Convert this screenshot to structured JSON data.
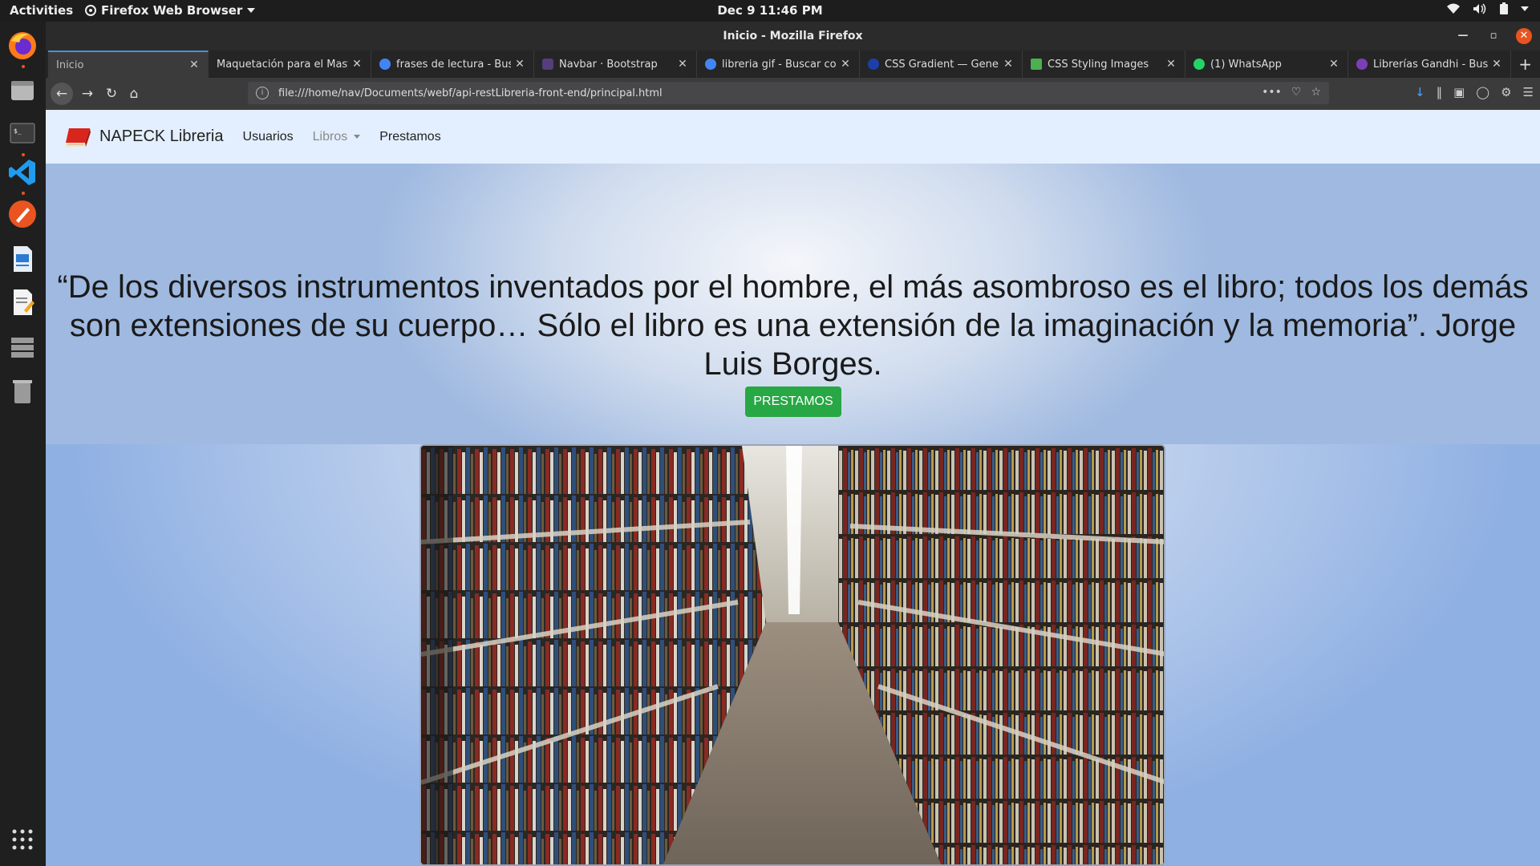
{
  "system": {
    "activities": "Activities",
    "app_menu": "Firefox Web Browser",
    "clock": "Dec 9  11:46 PM"
  },
  "window": {
    "title": "Inicio - Mozilla Firefox"
  },
  "tabs": [
    {
      "label": "Inicio",
      "active": true,
      "favicon_color": ""
    },
    {
      "label": "Maquetación para el Master",
      "active": false,
      "favicon_color": ""
    },
    {
      "label": "frases de lectura - Buscar",
      "active": false,
      "favicon_color": "#4285f4"
    },
    {
      "label": "Navbar · Bootstrap",
      "active": false,
      "favicon_color": "#563d7c"
    },
    {
      "label": "libreria gif - Buscar con",
      "active": false,
      "favicon_color": "#4285f4"
    },
    {
      "label": "CSS Gradient — Generator",
      "active": false,
      "favicon_color": "#1e3fa8"
    },
    {
      "label": "CSS Styling Images",
      "active": false,
      "favicon_color": "#4caf50"
    },
    {
      "label": "(1) WhatsApp",
      "active": false,
      "favicon_color": "#25d366"
    },
    {
      "label": "Librerías Gandhi - Buscar",
      "active": false,
      "favicon_color": "#7b3fb5"
    }
  ],
  "urlbar": {
    "url": "file:///home/nav/Documents/webf/api-restLibreria-front-end/principal.html"
  },
  "site": {
    "brand": "NAPECK Libreria",
    "nav": {
      "usuarios": "Usuarios",
      "libros": "Libros",
      "prestamos": "Prestamos"
    },
    "quote": "“De los diversos instrumentos inventados por el hombre, el más asombroso es el libro; todos los demás son extensiones de su cuerpo… Sólo el libro es una extensión de la imaginación y la memoria”. Jorge Luis Borges.",
    "cta_label": "PRESTAMOS",
    "cta_color": "#28a745",
    "nav_bg": "#e3efff"
  },
  "icons": {
    "back": "back-arrow-icon",
    "forward": "forward-arrow-icon",
    "reload": "reload-icon",
    "home": "home-icon"
  }
}
